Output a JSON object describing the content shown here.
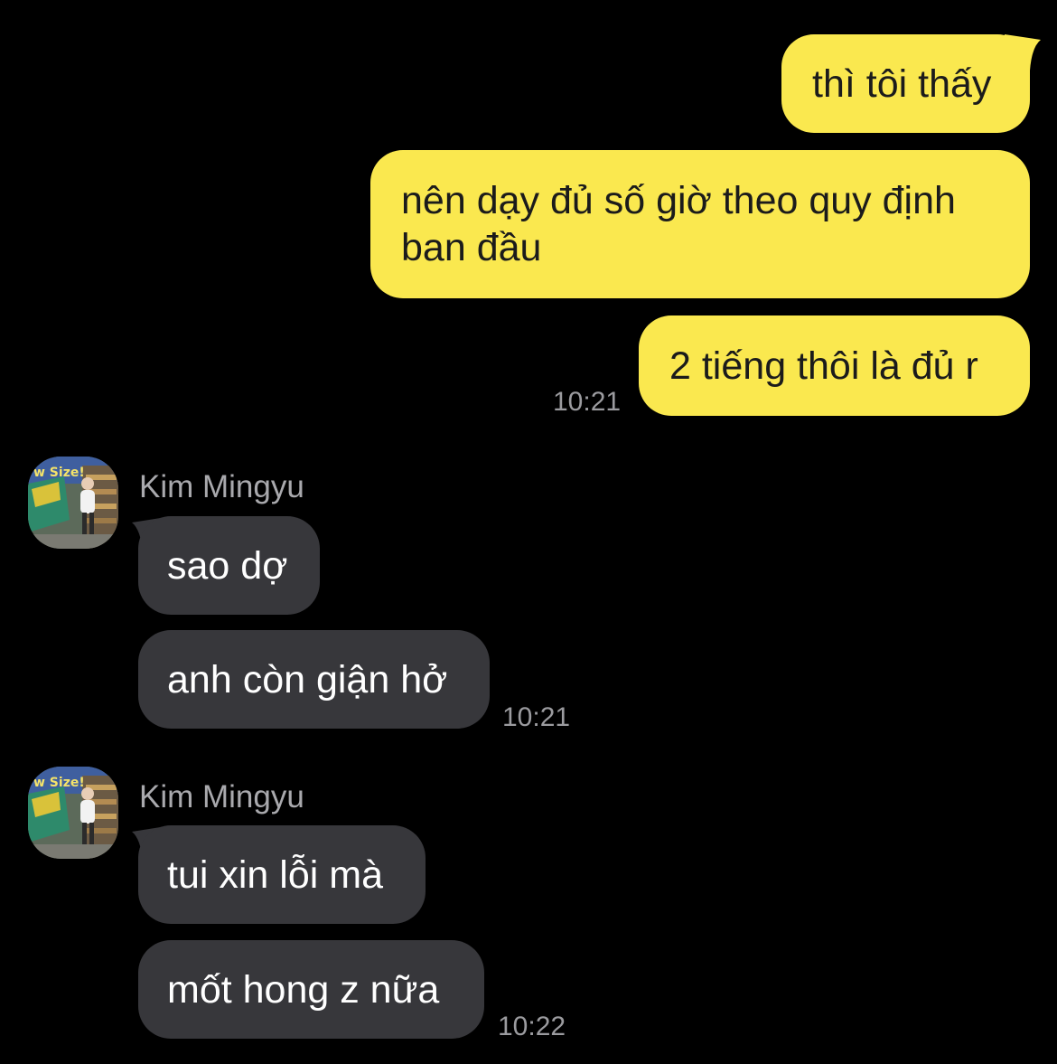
{
  "conversation": {
    "outgoing": [
      {
        "text": "thì tôi thấy"
      },
      {
        "text": "nên dạy đủ số giờ theo quy định\nban đầu"
      },
      {
        "text": "2 tiếng thôi là đủ r",
        "time": "10:21"
      }
    ],
    "incoming_groups": [
      {
        "sender": "Kim Mingyu",
        "avatar_icon": "profile-photo-icon",
        "messages": [
          {
            "text": "sao dợ"
          },
          {
            "text": "anh còn giận hở",
            "time": "10:21"
          }
        ]
      },
      {
        "sender": "Kim Mingyu",
        "avatar_icon": "profile-photo-icon",
        "messages": [
          {
            "text": "tui xin lỗi mà"
          },
          {
            "text": "mốt hong z nữa",
            "time": "10:22"
          }
        ]
      }
    ]
  },
  "colors": {
    "background": "#000000",
    "outgoing_bubble": "#fae84f",
    "incoming_bubble": "#37373b",
    "timestamp": "#9b9b9f",
    "sender_name": "#a9a9ad"
  }
}
